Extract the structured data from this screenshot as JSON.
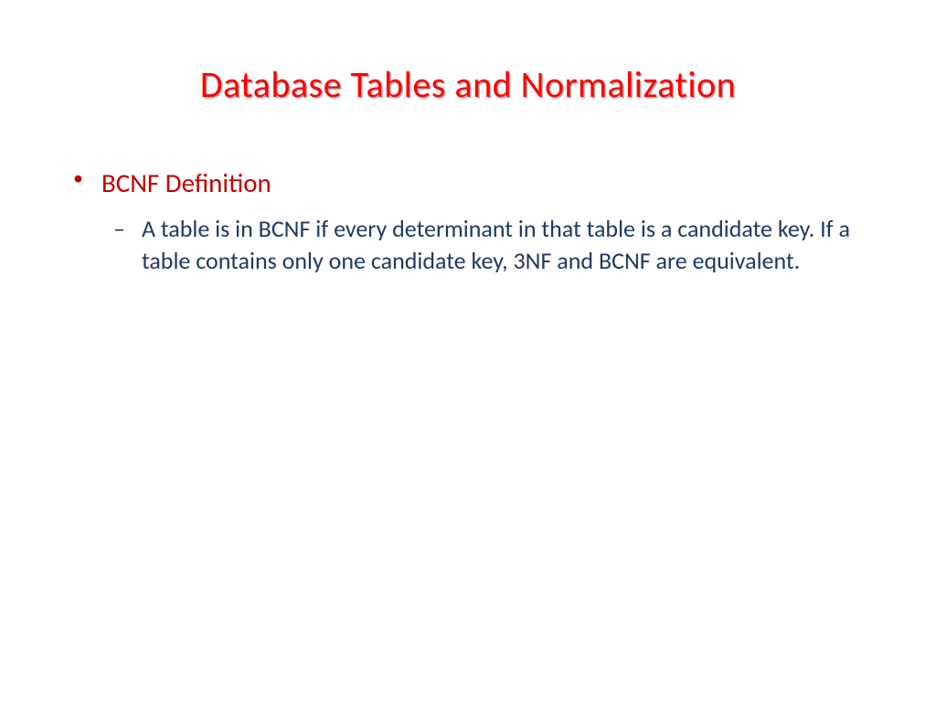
{
  "slide": {
    "title": "Database Tables and Normalization",
    "bullets": {
      "level1_marker": "•",
      "level1_text": "BCNF Definition",
      "level2_marker": "–",
      "level2_text": "A table is in BCNF if every determinant in that table is a candidate key. If a table contains only one candidate key, 3NF and BCNF are equivalent."
    }
  }
}
